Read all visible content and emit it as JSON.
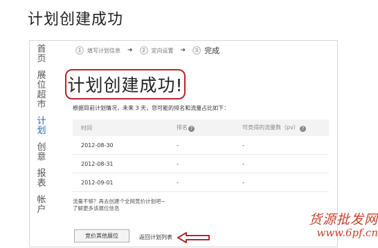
{
  "page_title": "计划创建成功",
  "sidebar": {
    "items": [
      {
        "label": "首页"
      },
      {
        "label": "展位超市"
      },
      {
        "label": "计划"
      },
      {
        "label": "创意"
      },
      {
        "label": "报表"
      },
      {
        "label": "帐户"
      }
    ]
  },
  "steps": [
    {
      "num": "1",
      "label": "填写计划信息"
    },
    {
      "num": "2",
      "label": "定向设置"
    },
    {
      "num": "3",
      "label": "完成"
    }
  ],
  "step_arrow": "➜",
  "success_title": "计划创建成功!",
  "description": "根据目前计划情况，未来 3 天，您可能的排名和流量占比如下：",
  "table": {
    "headers": [
      "时间",
      "排名",
      "可竞得的流量数（pv）"
    ],
    "help_glyph": "?",
    "rows": [
      [
        "2012-08-30",
        "-",
        "-"
      ],
      [
        "2012-08-31",
        "-",
        "-"
      ],
      [
        "2012-09-01",
        "-",
        "-"
      ]
    ]
  },
  "tips": {
    "line1": "流量不够？再去创建个全网竞价计划吧~",
    "line2": "了解更多该展位信息"
  },
  "buttons": {
    "other_positions": "竞价其他展位",
    "return_list": "返回计划列表"
  },
  "colors": {
    "highlight_red": "#b3262b",
    "active_nav": "#2a6bb6",
    "watermark": "#c8402b"
  },
  "watermark": {
    "line1": "货源批发网",
    "line2": "www.6pf.cn"
  }
}
